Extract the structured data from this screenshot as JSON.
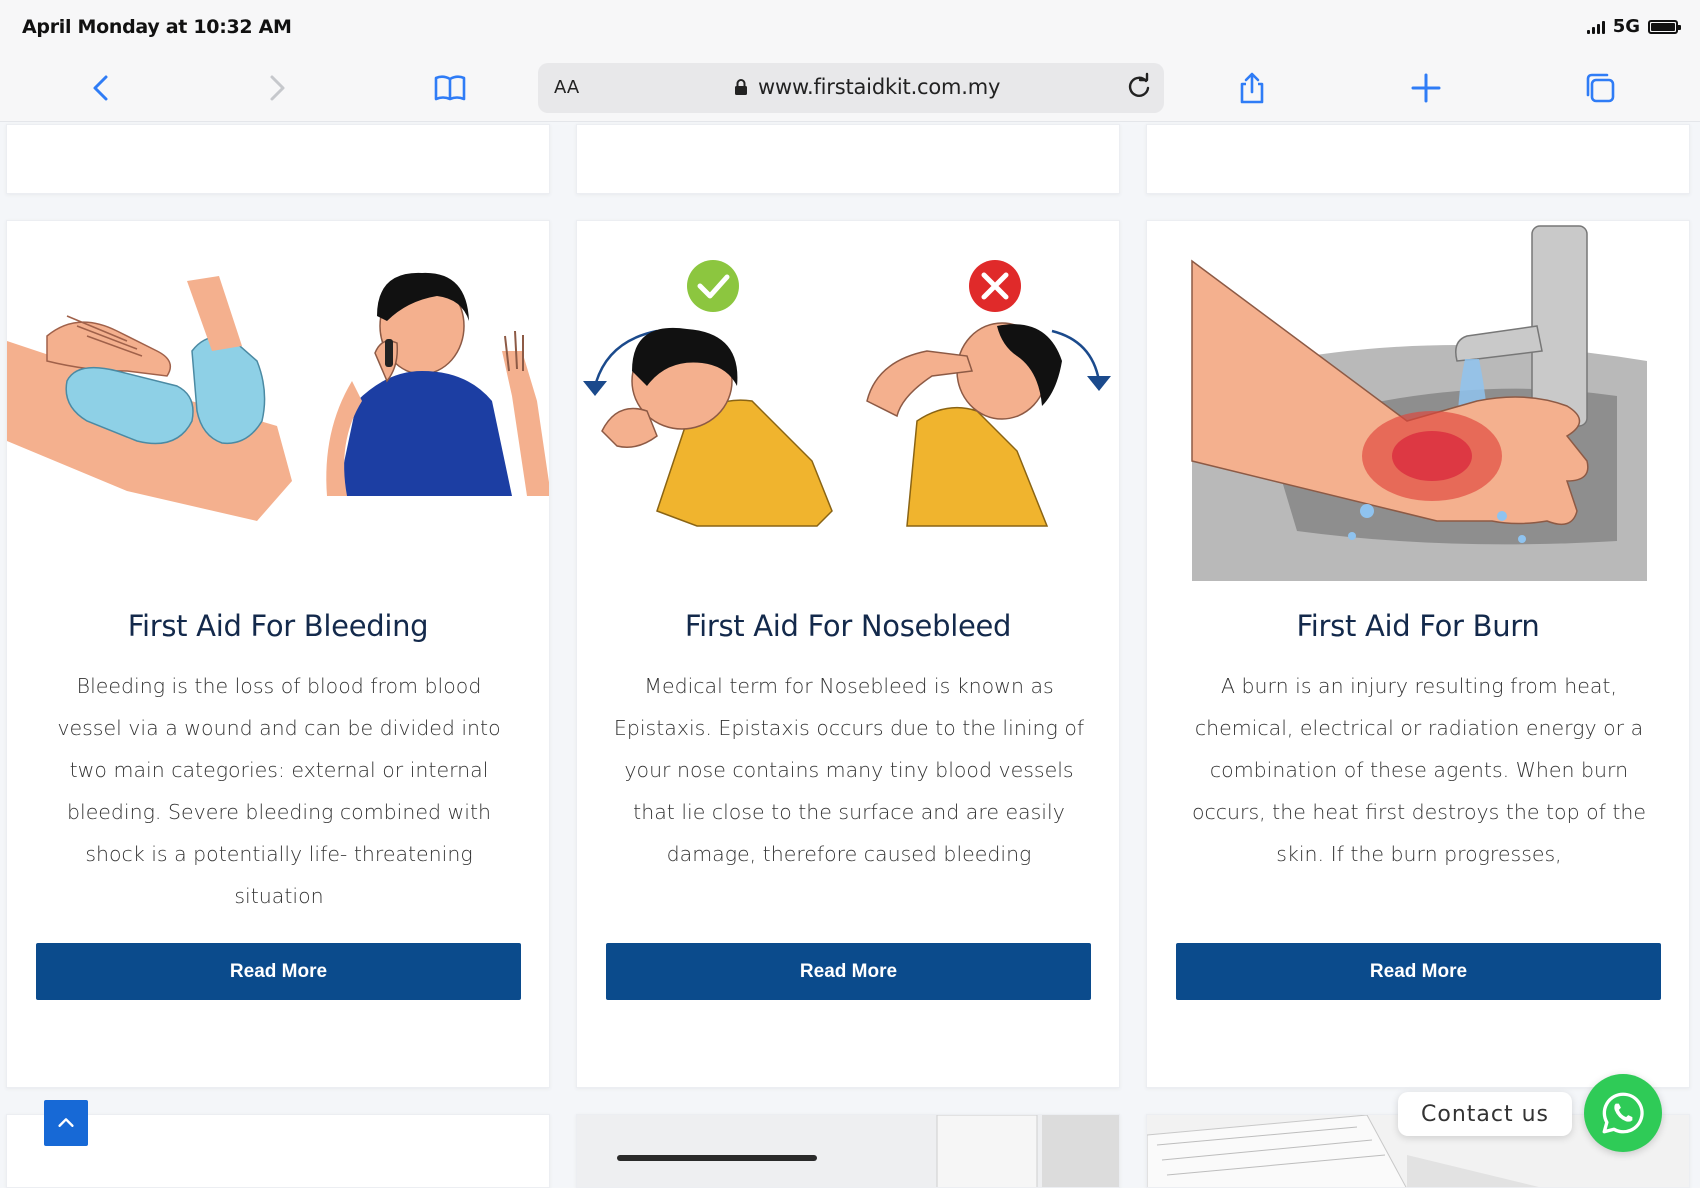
{
  "status_bar": {
    "time": "April Monday at 10:32 AM",
    "network": "5G"
  },
  "browser": {
    "text_size_label": "AA",
    "url": "www.firstaidkit.com.my",
    "icons": [
      "chevron-left-icon",
      "chevron-right-icon",
      "bookmarks-icon",
      "lock-icon",
      "reload-icon",
      "share-icon",
      "plus-icon",
      "tabs-icon"
    ]
  },
  "cards": [
    {
      "title": "First Aid For Bleeding",
      "description": "Bleeding is the loss of blood from blood vessel via a wound and can be divided into two main categories: external or internal bleeding. Severe bleeding combined with shock is a potentially life- threatening situation",
      "button_label": "Read More"
    },
    {
      "title": "First Aid For Nosebleed",
      "description": "Medical term for Nosebleed is known as Epistaxis. Epistaxis occurs due to the lining of your nose contains many tiny blood vessels that lie close to the surface and are easily damage, therefore caused bleeding",
      "button_label": "Read More"
    },
    {
      "title": "First Aid For Burn",
      "description": "A burn is an injury resulting from heat, chemical, electrical or radiation energy or a combination of these agents. When burn occurs, the heat first destroys the top of the skin. If the burn progresses,",
      "button_label": "Read More"
    }
  ],
  "floating": {
    "contact_label": "Contact us"
  },
  "colors": {
    "accent_blue": "#0b4b8c",
    "title_navy": "#13294b",
    "ios_blue": "#2f7cf6",
    "whatsapp_green": "#2fcb57"
  }
}
